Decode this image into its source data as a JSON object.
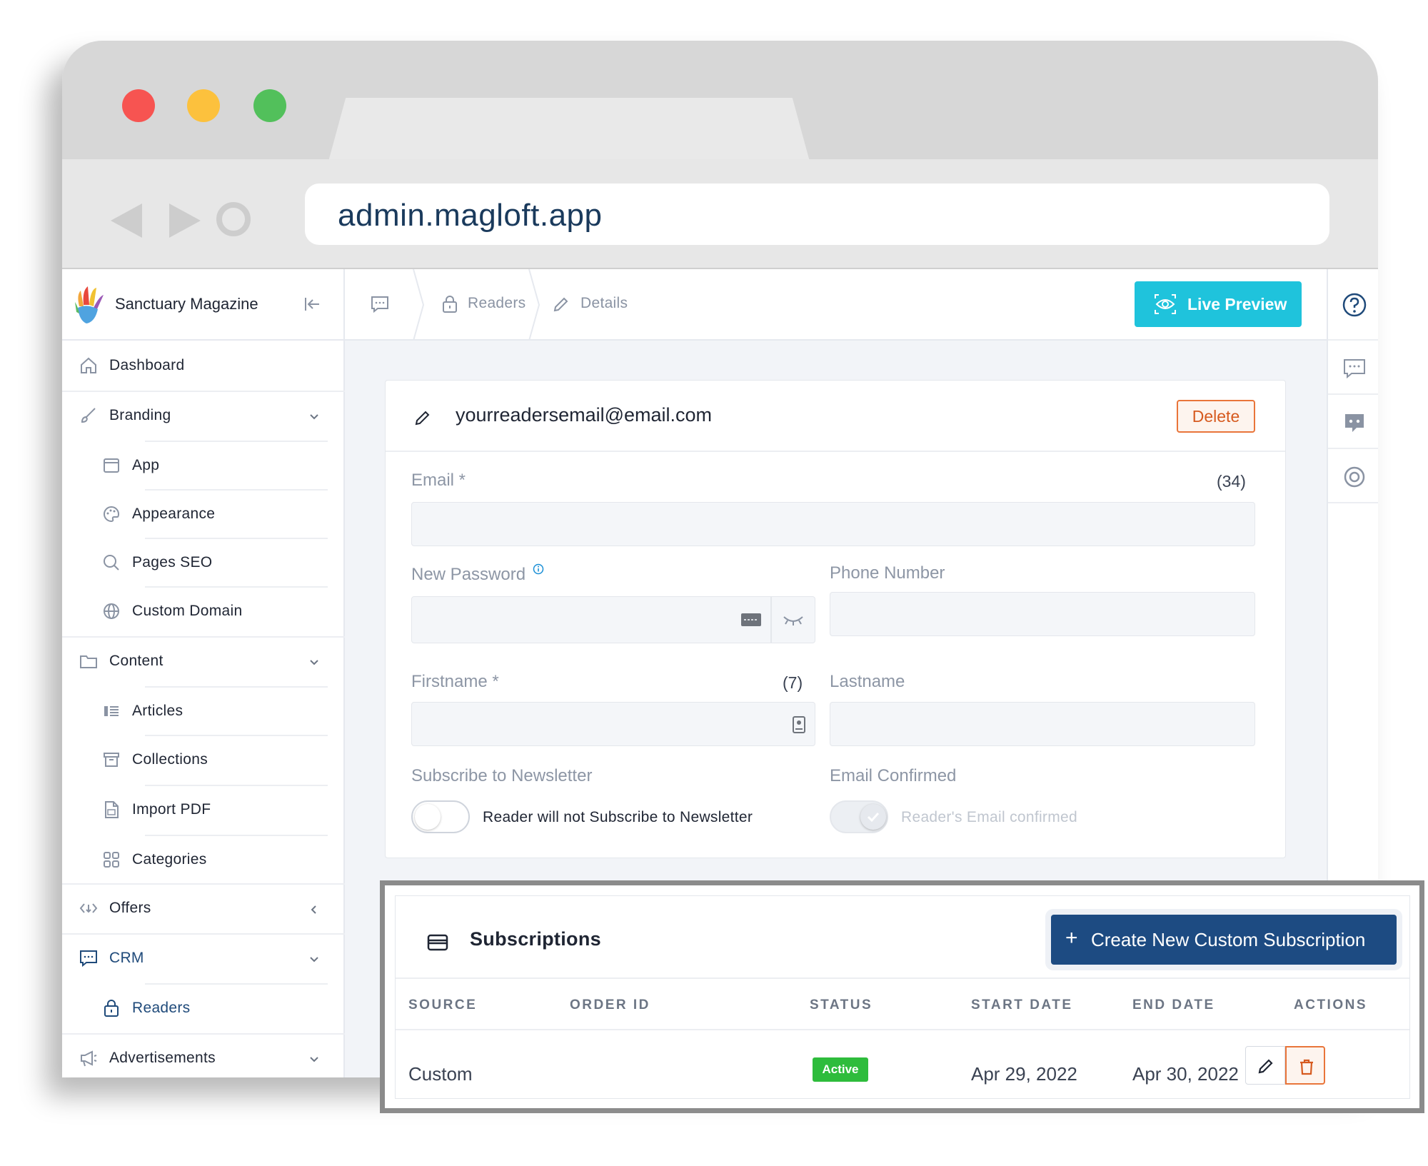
{
  "browser": {
    "url": "admin.magloft.app"
  },
  "sidebar": {
    "brand": "Sanctuary Magazine",
    "items": [
      {
        "label": "Dashboard",
        "icon": "home-icon"
      },
      {
        "label": "Branding",
        "icon": "brush-icon"
      },
      {
        "label": "App",
        "icon": "window-icon"
      },
      {
        "label": "Appearance",
        "icon": "palette-icon"
      },
      {
        "label": "Pages SEO",
        "icon": "search-icon"
      },
      {
        "label": "Custom Domain",
        "icon": "globe-icon"
      },
      {
        "label": "Content",
        "icon": "folder-icon"
      },
      {
        "label": "Articles",
        "icon": "articles-icon"
      },
      {
        "label": "Collections",
        "icon": "archive-icon"
      },
      {
        "label": "Import PDF",
        "icon": "pdf-file-icon"
      },
      {
        "label": "Categories",
        "icon": "grid-icon"
      },
      {
        "label": "Offers",
        "icon": "offers-icon"
      },
      {
        "label": "CRM",
        "icon": "chat-icon"
      },
      {
        "label": "Readers",
        "icon": "lock-bag-icon"
      },
      {
        "label": "Advertisements",
        "icon": "megaphone-icon"
      }
    ]
  },
  "header": {
    "breadcrumbs": [
      "Readers",
      "Details"
    ],
    "live_preview": "Live Preview"
  },
  "reader": {
    "title": "yourreadersemail@email.com",
    "delete_label": "Delete",
    "email_label": "Email *",
    "email_count": "(34)",
    "email_value": "",
    "password_label": "New Password",
    "phone_label": "Phone Number",
    "firstname_label": "Firstname *",
    "firstname_count": "(7)",
    "lastname_label": "Lastname",
    "newsletter_label": "Subscribe to Newsletter",
    "newsletter_text": "Reader will not Subscribe to Newsletter",
    "newsletter_on": false,
    "confirmed_label": "Email Confirmed",
    "confirmed_text": "Reader's Email confirmed",
    "confirmed_on": true
  },
  "subscriptions": {
    "title": "Subscriptions",
    "create_label": "Create New Custom Subscription",
    "columns": [
      "SOURCE",
      "ORDER ID",
      "STATUS",
      "START DATE",
      "END DATE",
      "ACTIONS"
    ],
    "rows": [
      {
        "source": "Custom",
        "order_id": "",
        "status": "Active",
        "start": "Apr 29, 2022",
        "end": "Apr 30, 2022"
      }
    ]
  },
  "colors": {
    "accent": "#1fc3dc",
    "primary": "#1d4b82",
    "danger": "#e9753a",
    "success": "#2ebc3c"
  }
}
